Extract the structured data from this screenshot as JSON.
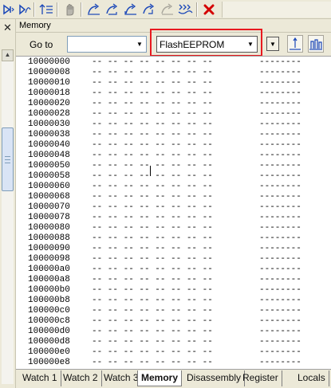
{
  "toolbar": {
    "icons": [
      "step-into-icon",
      "step-over-icon",
      "step-out-icon",
      "stop-icon",
      "run-to-cursor-icon",
      "breakpoint-icon",
      "run-icon",
      "run-free-icon",
      "animate-icon",
      "cancel-icon"
    ]
  },
  "panel": {
    "title": "Memory"
  },
  "goto": {
    "label": "Go to",
    "address_value": ""
  },
  "memory_space": {
    "selected": "FlashEEPROM"
  },
  "memory": {
    "rows": [
      {
        "addr": "10000000",
        "bytes": "-- -- -- -- -- -- -- --",
        "ascii": "--------"
      },
      {
        "addr": "10000008",
        "bytes": "-- -- -- -- -- -- -- --",
        "ascii": "--------"
      },
      {
        "addr": "10000010",
        "bytes": "-- -- -- -- -- -- -- --",
        "ascii": "--------"
      },
      {
        "addr": "10000018",
        "bytes": "-- -- -- -- -- -- -- --",
        "ascii": "--------"
      },
      {
        "addr": "10000020",
        "bytes": "-- -- -- -- -- -- -- --",
        "ascii": "--------"
      },
      {
        "addr": "10000028",
        "bytes": "-- -- -- -- -- -- -- --",
        "ascii": "--------"
      },
      {
        "addr": "10000030",
        "bytes": "-- -- -- -- -- -- -- --",
        "ascii": "--------"
      },
      {
        "addr": "10000038",
        "bytes": "-- -- -- -- -- -- -- --",
        "ascii": "--------"
      },
      {
        "addr": "10000040",
        "bytes": "-- -- -- -- -- -- -- --",
        "ascii": "--------"
      },
      {
        "addr": "10000048",
        "bytes": "-- -- -- -- -- -- -- --",
        "ascii": "--------"
      },
      {
        "addr": "10000050",
        "bytes": "-- -- -- -- -- -- -- --",
        "ascii": "--------"
      },
      {
        "addr": "10000058",
        "bytes": "-- -- -- -- -- -- -- --",
        "ascii": "--------"
      },
      {
        "addr": "10000060",
        "bytes": "-- -- -- -- -- -- -- --",
        "ascii": "--------"
      },
      {
        "addr": "10000068",
        "bytes": "-- -- -- -- -- -- -- --",
        "ascii": "--------"
      },
      {
        "addr": "10000070",
        "bytes": "-- -- -- -- -- -- -- --",
        "ascii": "--------"
      },
      {
        "addr": "10000078",
        "bytes": "-- -- -- -- -- -- -- --",
        "ascii": "--------"
      },
      {
        "addr": "10000080",
        "bytes": "-- -- -- -- -- -- -- --",
        "ascii": "--------"
      },
      {
        "addr": "10000088",
        "bytes": "-- -- -- -- -- -- -- --",
        "ascii": "--------"
      },
      {
        "addr": "10000090",
        "bytes": "-- -- -- -- -- -- -- --",
        "ascii": "--------"
      },
      {
        "addr": "10000098",
        "bytes": "-- -- -- -- -- -- -- --",
        "ascii": "--------"
      },
      {
        "addr": "100000a0",
        "bytes": "-- -- -- -- -- -- -- --",
        "ascii": "--------"
      },
      {
        "addr": "100000a8",
        "bytes": "-- -- -- -- -- -- -- --",
        "ascii": "--------"
      },
      {
        "addr": "100000b0",
        "bytes": "-- -- -- -- -- -- -- --",
        "ascii": "--------"
      },
      {
        "addr": "100000b8",
        "bytes": "-- -- -- -- -- -- -- --",
        "ascii": "--------"
      },
      {
        "addr": "100000c0",
        "bytes": "-- -- -- -- -- -- -- --",
        "ascii": "--------"
      },
      {
        "addr": "100000c8",
        "bytes": "-- -- -- -- -- -- -- --",
        "ascii": "--------"
      },
      {
        "addr": "100000d0",
        "bytes": "-- -- -- -- -- -- -- --",
        "ascii": "--------"
      },
      {
        "addr": "100000d8",
        "bytes": "-- -- -- -- -- -- -- --",
        "ascii": "--------"
      },
      {
        "addr": "100000e0",
        "bytes": "-- -- -- -- -- -- -- --",
        "ascii": "--------"
      },
      {
        "addr": "100000e8",
        "bytes": "-- -- -- -- -- -- -- --",
        "ascii": "--------"
      }
    ]
  },
  "tabs": [
    {
      "label": "Watch 1",
      "active": false
    },
    {
      "label": "Watch 2",
      "active": false
    },
    {
      "label": "Watch 3",
      "active": false
    },
    {
      "label": "Memory",
      "active": true
    },
    {
      "label": "Disassembly",
      "active": false
    },
    {
      "label": "Register",
      "active": false
    },
    {
      "label": "Locals",
      "active": false
    }
  ],
  "colors": {
    "highlight": "#e8191f",
    "cancel_icon": "#d40000",
    "toolbar_icons": "#1a47b8"
  }
}
